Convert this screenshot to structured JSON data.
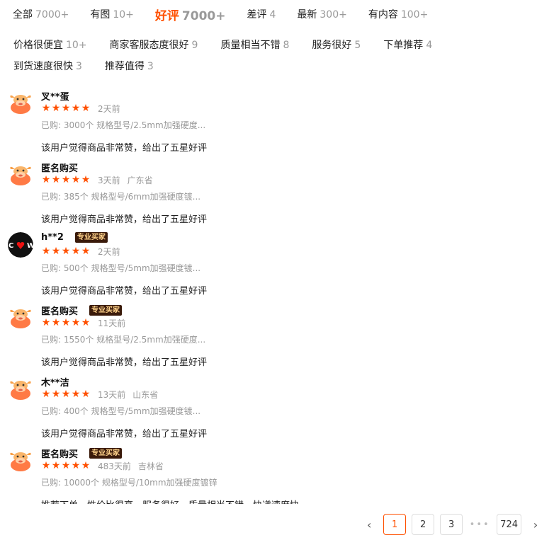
{
  "filter_tabs": [
    {
      "label": "全部",
      "count": "7000+"
    },
    {
      "label": "有图",
      "count": "10+"
    },
    {
      "label": "好评",
      "count": "7000+"
    },
    {
      "label": "差评",
      "count": "4"
    },
    {
      "label": "最新",
      "count": "300+"
    },
    {
      "label": "有内容",
      "count": "100+"
    }
  ],
  "active_tab_index": 2,
  "tag_filters": [
    {
      "label": "价格很便宜",
      "count": "10+"
    },
    {
      "label": "商家客服态度很好",
      "count": "9"
    },
    {
      "label": "质量相当不错",
      "count": "8"
    },
    {
      "label": "服务很好",
      "count": "5"
    },
    {
      "label": "下单推荐",
      "count": "4"
    },
    {
      "label": "到货速度很快",
      "count": "3"
    },
    {
      "label": "推荐值得",
      "count": "3"
    }
  ],
  "reviews": [
    {
      "user": "叉**蛋",
      "badge": "",
      "rating": 5,
      "time": "2天前",
      "region": "",
      "bought": "已购: 3000个 规格型号/2.5mm加强硬度...",
      "content": "该用户觉得商品非常赞，给出了五星好评",
      "avatar": "bull-avatar-icon"
    },
    {
      "user": "匿名购买",
      "badge": "",
      "rating": 5,
      "time": "3天前",
      "region": "广东省",
      "bought": "已购: 385个 规格型号/6mm加强硬度镀...",
      "content": "该用户觉得商品非常赞，给出了五星好评",
      "avatar": "bull-avatar-icon"
    },
    {
      "user": "h**2",
      "badge": "专业买家",
      "rating": 5,
      "time": "2天前",
      "region": "",
      "bought": "已购: 500个 规格型号/5mm加强硬度镀...",
      "content": "该用户觉得商品非常赞，给出了五星好评",
      "avatar": "photo-avatar"
    },
    {
      "user": "匿名购买",
      "badge": "专业买家",
      "rating": 5,
      "time": "11天前",
      "region": "",
      "bought": "已购: 1550个 规格型号/2.5mm加强硬度...",
      "content": "该用户觉得商品非常赞，给出了五星好评",
      "avatar": "bull-avatar-icon"
    },
    {
      "user": "木**洁",
      "badge": "",
      "rating": 5,
      "time": "13天前",
      "region": "山东省",
      "bought": "已购: 400个 规格型号/5mm加强硬度镀...",
      "content": "该用户觉得商品非常赞，给出了五星好评",
      "avatar": "bull-avatar-icon"
    },
    {
      "user": "匿名购买",
      "badge": "专业买家",
      "rating": 5,
      "time": "483天前",
      "region": "吉林省",
      "bought": "已购: 10000个 规格型号/10mm加强硬度镀锌",
      "content": "推荐下单，性价比很高，服务很好，质量相当不错，快递速度快",
      "avatar": "bull-avatar-icon"
    }
  ],
  "pagination": {
    "prev": "‹",
    "pages": [
      "1",
      "2",
      "3"
    ],
    "current": "1",
    "ellipsis": "•••",
    "last": "724",
    "next": "›"
  },
  "colors": {
    "accent": "#ff5000",
    "muted": "#999999",
    "badge_bg": "#3a1a0a",
    "badge_fg": "#ffd28a"
  }
}
